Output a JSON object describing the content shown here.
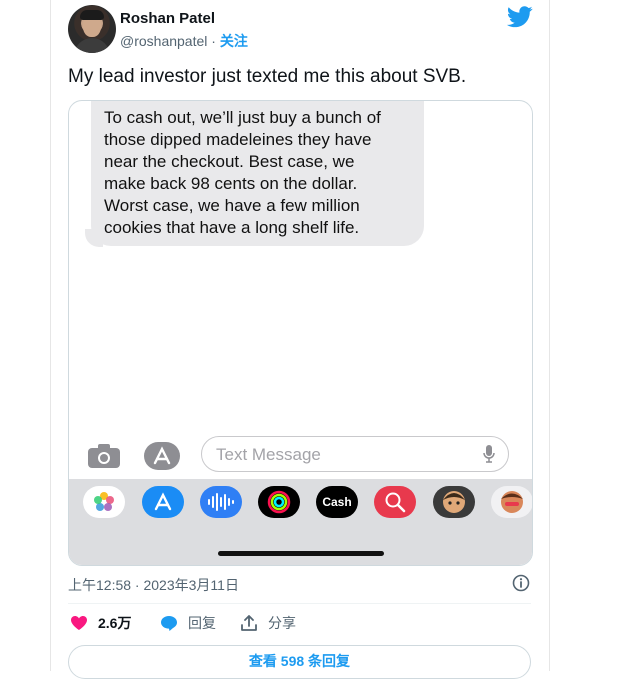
{
  "author": {
    "name": "Roshan Patel",
    "handle": "@roshanpatel",
    "separator": "·",
    "follow_label": "关注"
  },
  "tweet": {
    "text": "My lead investor just texted me this about SVB.",
    "timestamp": "上午12:58 · 2023年3月11日"
  },
  "screenshot": {
    "message_lines": [
      "To cash out, we’ll just buy a bunch of",
      "those dipped madeleines they have",
      "near the checkout. Best case, we",
      "make back 98 cents on the dollar.",
      "Worst case, we have a few million",
      "cookies that have a long shelf life."
    ],
    "text_field_placeholder": "Text Message",
    "cash_label": "Cash",
    "apple_glyph": "",
    "tray_apps": [
      "photos-icon",
      "app-store-icon",
      "audio-icon",
      "activity-icon",
      "apple-cash-icon",
      "search-globe-icon",
      "memoji-icon",
      "memoji-icon-2"
    ]
  },
  "actions": {
    "like_count": "2.6万",
    "reply_label": "回复",
    "share_label": "分享"
  },
  "replies_button": "查看 598 条回复",
  "colors": {
    "accent": "#1d9bf0",
    "like": "#f91880",
    "muted": "#536471",
    "bubble": "#e9e9eb",
    "tray": "#dcdde0"
  }
}
